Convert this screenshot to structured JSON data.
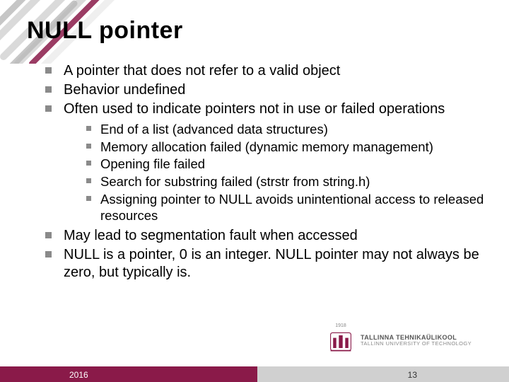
{
  "title": "NULL pointer",
  "bullets_top": [
    "A pointer that does not refer to a valid object",
    "Behavior undefined",
    "Often used to indicate pointers not in use or failed operations"
  ],
  "sub_bullets": [
    "End of a list (advanced data structures)",
    "Memory allocation failed (dynamic memory management)",
    "Opening file failed",
    "Search for substring failed (strstr from string.h)",
    "Assigning pointer to NULL avoids unintentional access to released resources"
  ],
  "bullets_bottom": [
    "May lead to segmentation fault when accessed",
    "NULL is a pointer, 0 is an integer. NULL pointer may not always be zero, but typically is."
  ],
  "footer": {
    "year": "2016",
    "page": "13"
  },
  "logo": {
    "founding_year": "1918",
    "line1": "TALLINNA TEHNIKAÜLIKOOL",
    "line2": "TALLINN UNIVERSITY OF TECHNOLOGY"
  },
  "colors": {
    "brand": "#8a1a49",
    "footer_grey": "#d0d0d0",
    "bullet_grey": "#8a8a8a"
  }
}
